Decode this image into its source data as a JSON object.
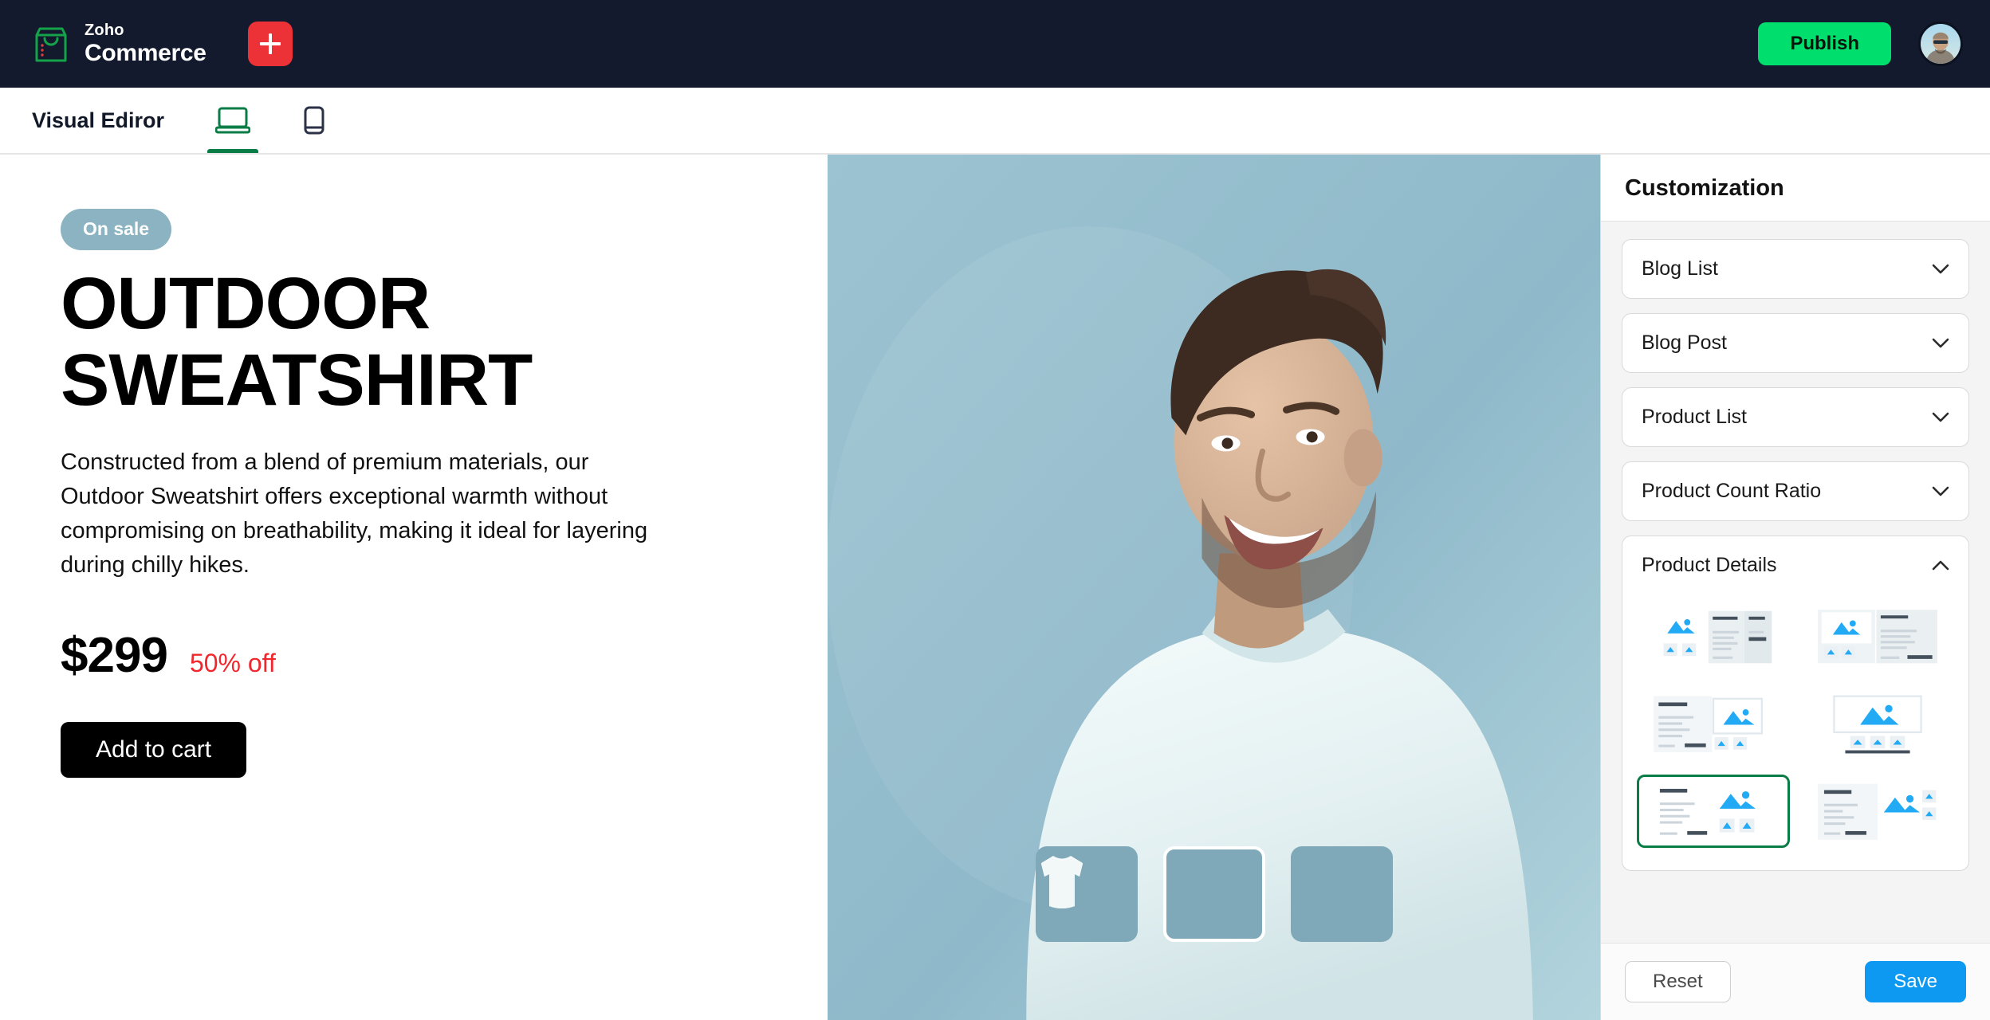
{
  "topbar": {
    "brand_zoho": "Zoho",
    "brand_commerce": "Commerce",
    "add_label": "+",
    "publish_label": "Publish",
    "accent_green": "#00df6d",
    "accent_red": "#ed3237",
    "background": "#141a2e"
  },
  "subbar": {
    "title": "Visual Ediror",
    "devices": [
      {
        "name": "desktop",
        "active": true
      },
      {
        "name": "mobile",
        "active": false
      }
    ],
    "active_color": "#0a7c45"
  },
  "product": {
    "badge": "On sale",
    "title": "OUTDOOR SWEATSHIRT",
    "description": "Constructed from a blend of premium materials, our Outdoor Sweatshirt offers exceptional warmth without compromising on breathability, making it ideal for layering during chilly hikes.",
    "price": "$299",
    "discount": "50% off",
    "cart_label": "Add to cart",
    "badge_color": "#8bb3c1",
    "discount_color": "#f0282d",
    "thumbnails": [
      {
        "label": "sweatshirt-front",
        "selected": false
      },
      {
        "label": "sweatshirt-back",
        "selected": true
      },
      {
        "label": "sweatshirt-side",
        "selected": false
      }
    ]
  },
  "panel": {
    "title": "Customization",
    "sections": [
      {
        "label": "Blog List",
        "expanded": false
      },
      {
        "label": "Blog Post",
        "expanded": false
      },
      {
        "label": "Product List",
        "expanded": false
      },
      {
        "label": "Product Count Ratio",
        "expanded": false
      },
      {
        "label": "Product Details",
        "expanded": true
      }
    ],
    "product_details_layouts": [
      {
        "id": "layout-1",
        "selected": false
      },
      {
        "id": "layout-2",
        "selected": false
      },
      {
        "id": "layout-3",
        "selected": false
      },
      {
        "id": "layout-4",
        "selected": false
      },
      {
        "id": "layout-5",
        "selected": true
      },
      {
        "id": "layout-6",
        "selected": false
      }
    ],
    "selected_layout_color": "#0a7c45",
    "reset_label": "Reset",
    "save_label": "Save",
    "save_color": "#0d99f2"
  }
}
